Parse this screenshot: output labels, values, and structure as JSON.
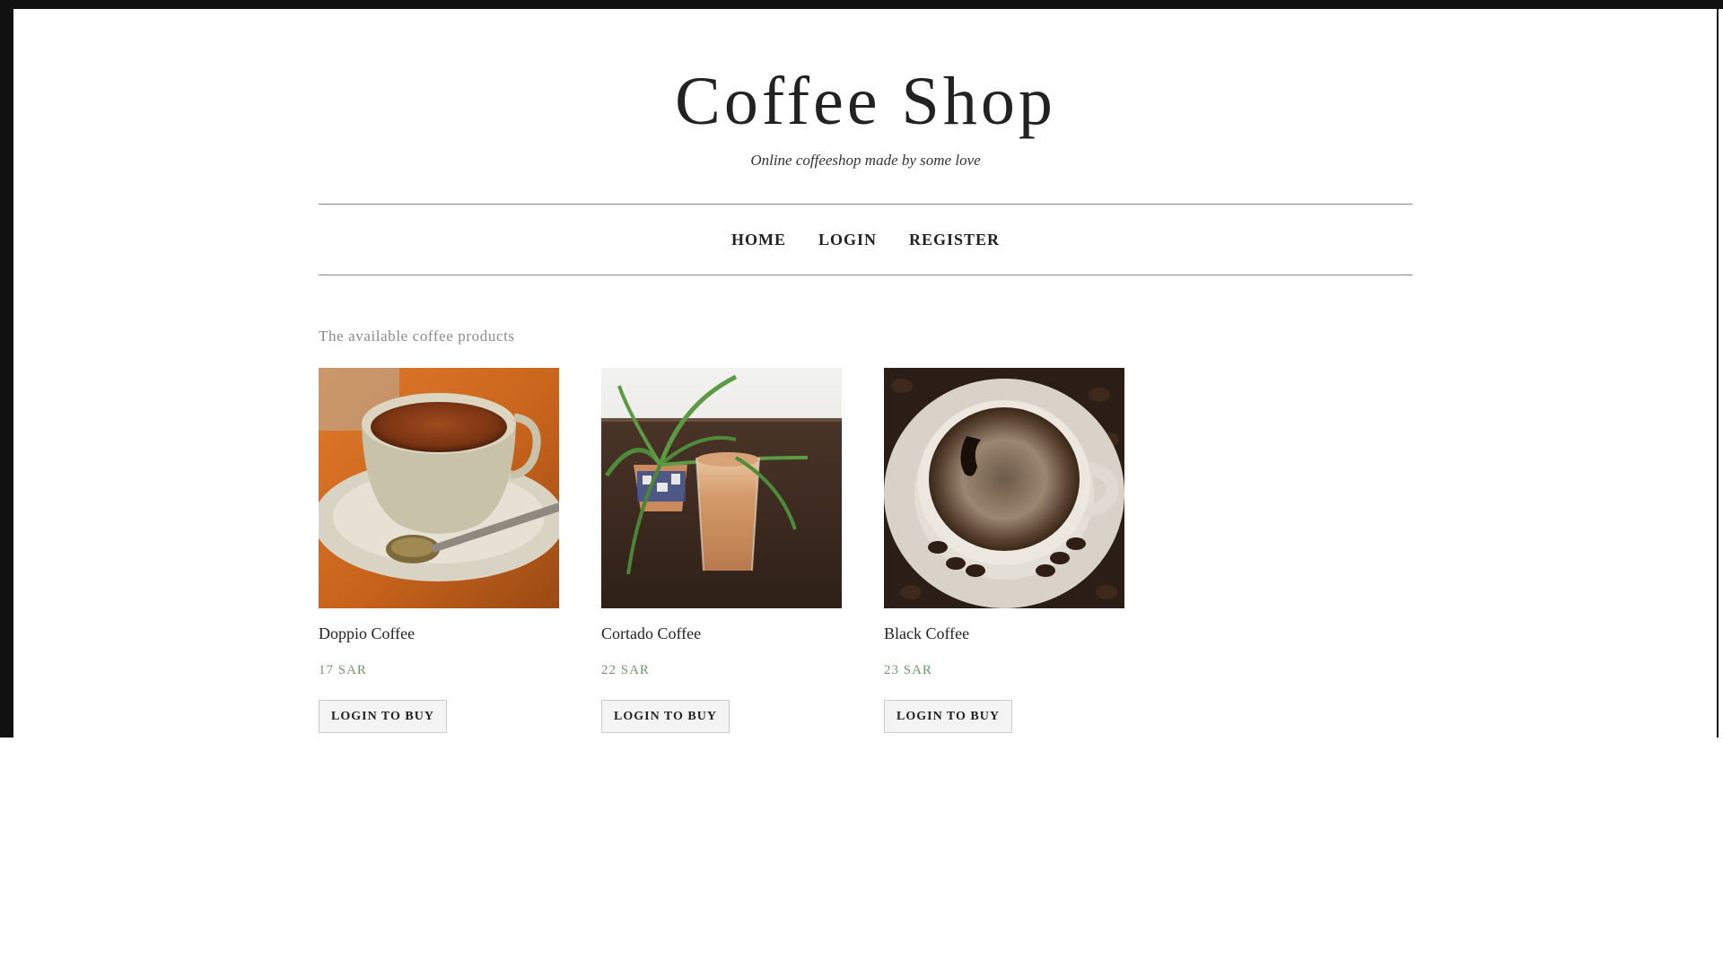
{
  "header": {
    "title": "Coffee Shop",
    "tagline": "Online coffeeshop made by some love"
  },
  "nav": {
    "items": [
      "HOME",
      "LOGIN",
      "REGISTER"
    ]
  },
  "main": {
    "heading": "The available coffee products",
    "products": [
      {
        "name": "Doppio Coffee",
        "price": "17 SAR",
        "button": "LOGIN TO BUY"
      },
      {
        "name": "Cortado Coffee",
        "price": "22 SAR",
        "button": "LOGIN TO BUY"
      },
      {
        "name": "Black Coffee",
        "price": "23 SAR",
        "button": "LOGIN TO BUY"
      }
    ]
  },
  "colors": {
    "price": "#6f9a6a",
    "frame": "#111111",
    "text": "#222222",
    "muted": "#8a8a8a"
  }
}
